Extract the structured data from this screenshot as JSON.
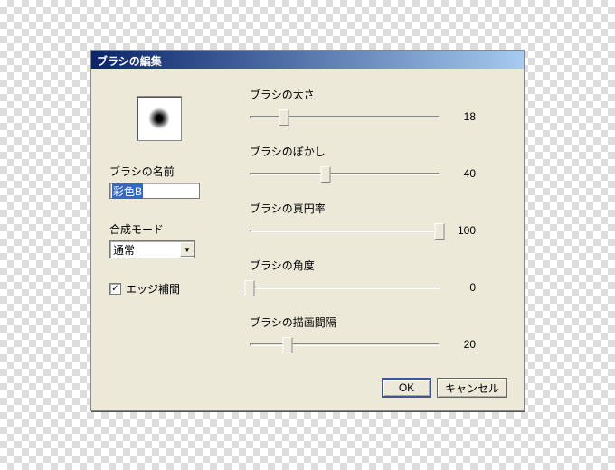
{
  "dialog": {
    "title": "ブラシの編集"
  },
  "leftPanel": {
    "nameLabel": "ブラシの名前",
    "nameValue": "彩色B",
    "modeLabel": "合成モード",
    "modeValue": "通常",
    "edgeCheckLabel": "エッジ補間",
    "edgeChecked": "✓"
  },
  "sliders": {
    "thickness": {
      "label": "ブラシの太さ",
      "value": "18",
      "pos": 18
    },
    "blur": {
      "label": "ブラシのぼかし",
      "value": "40",
      "pos": 40
    },
    "round": {
      "label": "ブラシの真円率",
      "value": "100",
      "pos": 100
    },
    "angle": {
      "label": "ブラシの角度",
      "value": "0",
      "pos": 0
    },
    "interval": {
      "label": "ブラシの描画間隔",
      "value": "20",
      "pos": 20
    }
  },
  "buttons": {
    "ok": "OK",
    "cancel": "キャンセル"
  }
}
